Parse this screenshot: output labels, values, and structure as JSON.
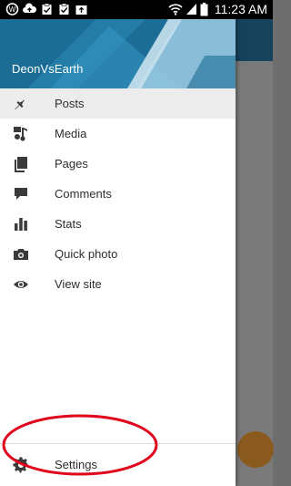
{
  "status_bar": {
    "time": "11:23 AM",
    "icons": [
      "wordpress-notification-icon",
      "cloud-upload-icon",
      "clipboard-check-icon",
      "clipboard-check-icon",
      "image-upload-icon",
      "wifi-icon",
      "cell-signal-icon",
      "battery-icon"
    ]
  },
  "drawer": {
    "blog_name": "DeonVsEarth",
    "menu": [
      {
        "label": "Posts",
        "icon": "pin-icon",
        "active": true
      },
      {
        "label": "Media",
        "icon": "media-icon"
      },
      {
        "label": "Pages",
        "icon": "pages-icon"
      },
      {
        "label": "Comments",
        "icon": "comment-icon"
      },
      {
        "label": "Stats",
        "icon": "stats-icon"
      },
      {
        "label": "Quick photo",
        "icon": "camera-icon"
      },
      {
        "label": "View site",
        "icon": "eye-icon"
      }
    ],
    "settings": {
      "label": "Settings",
      "icon": "gear-icon"
    }
  },
  "colors": {
    "header": "#1c6d95",
    "annotation": "#e0001b",
    "fab": "#8a5a1e"
  }
}
